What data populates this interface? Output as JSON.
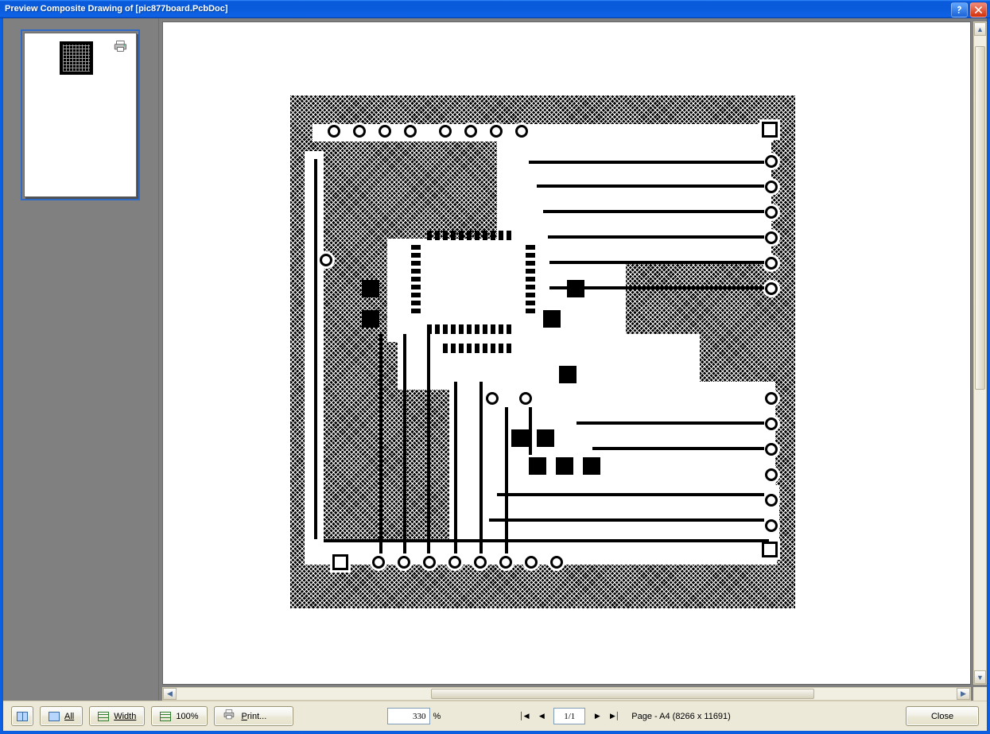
{
  "window": {
    "title": "Preview Composite Drawing of [pic877board.PcbDoc]"
  },
  "toolbar": {
    "all_label": "All",
    "width_label": "Width",
    "hundred_label": "100%",
    "print_label": "Print...",
    "close_label": "Close"
  },
  "zoom": {
    "value": "330",
    "unit": "%"
  },
  "pagination": {
    "current": "1/1",
    "info": "Page - A4 (8266 x 11691)"
  }
}
